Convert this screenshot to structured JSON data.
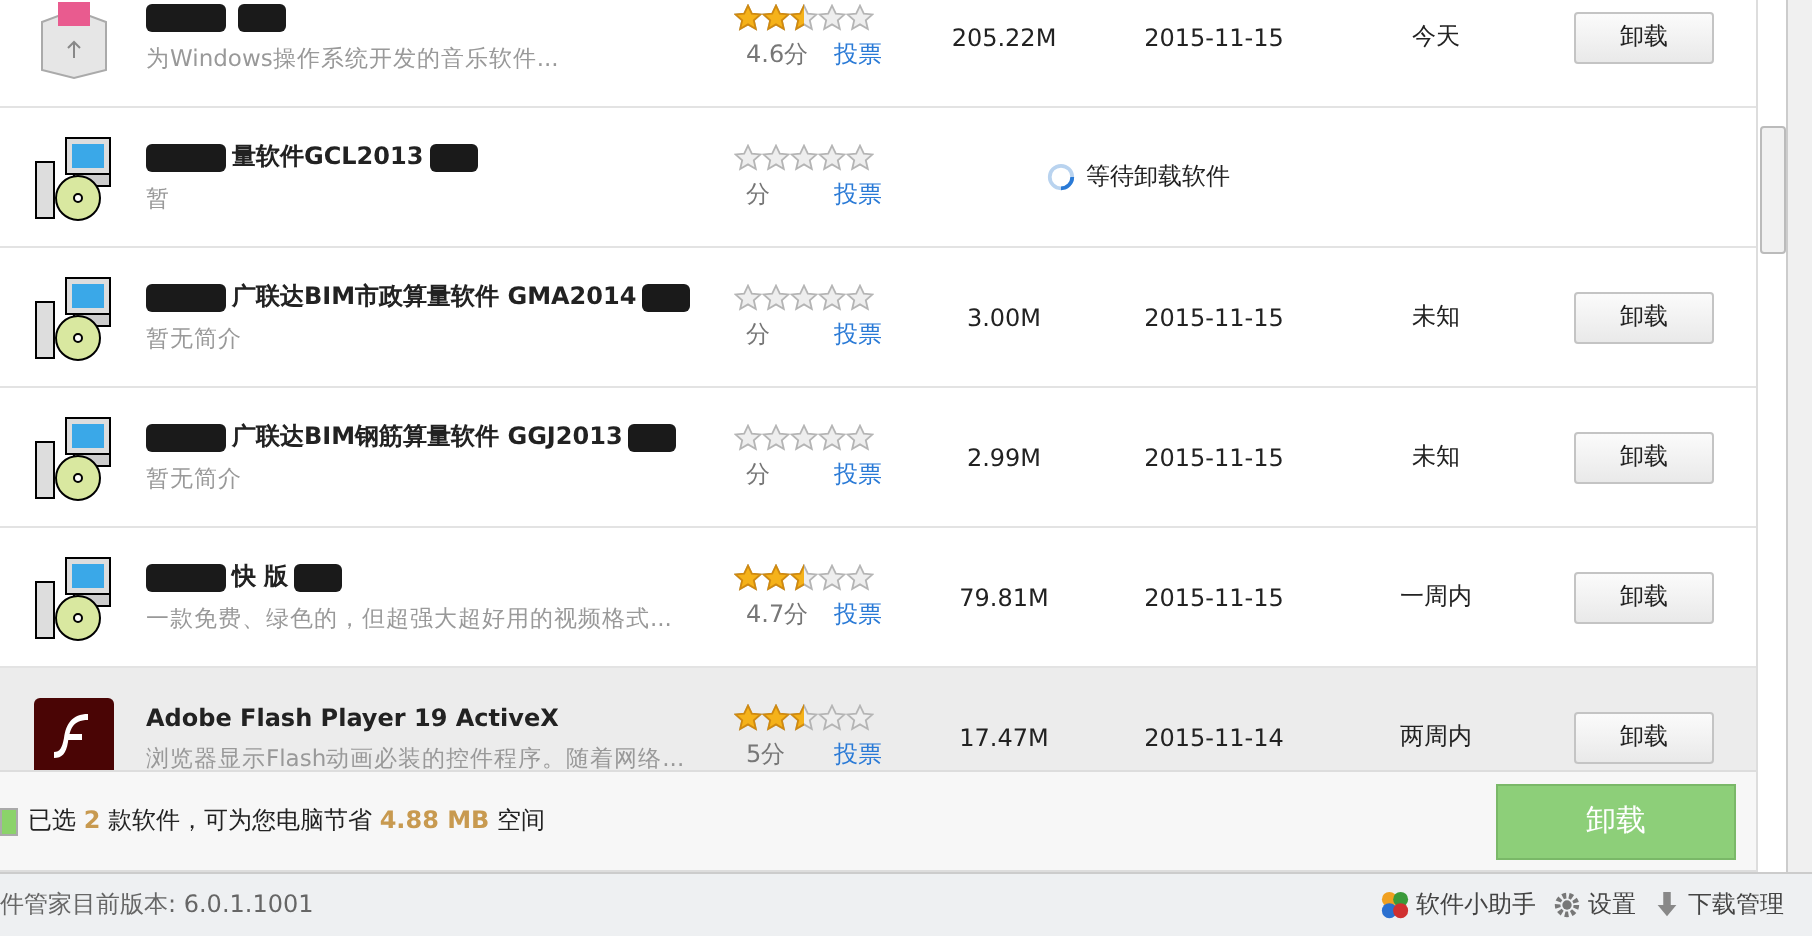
{
  "rows": [
    {
      "kind": "music",
      "name": "",
      "description": "为Windows操作系统开发的音乐软件...",
      "redacted": true,
      "stars": 2.5,
      "score": "4.6分",
      "vote": "投票",
      "size": "205.22M",
      "date": "2015-11-15",
      "last_used": "今天",
      "action": "卸载",
      "selected": false
    },
    {
      "kind": "installer",
      "name": "量软件GCL2013",
      "description": "暂",
      "redacted": true,
      "stars": 0,
      "score": "分",
      "vote": "投票",
      "status": "等待卸载软件",
      "selected": false
    },
    {
      "kind": "installer",
      "name": "广联达BIM市政算量软件 GMA2014",
      "description": "暂无简介",
      "redacted": true,
      "stars": 0,
      "score": "分",
      "vote": "投票",
      "size": "3.00M",
      "date": "2015-11-15",
      "last_used": "未知",
      "action": "卸载",
      "selected": false
    },
    {
      "kind": "installer",
      "name": "广联达BIM钢筋算量软件 GGJ2013",
      "description": "暂无简介",
      "redacted": true,
      "stars": 0,
      "score": "分",
      "vote": "投票",
      "size": "2.99M",
      "date": "2015-11-15",
      "last_used": "未知",
      "action": "卸载",
      "selected": false
    },
    {
      "kind": "installer",
      "name": "快 版",
      "description": "一款免费、绿色的，但超强大超好用的视频格式...",
      "redacted": true,
      "stars": 2.5,
      "score": "4.7分",
      "vote": "投票",
      "size": "79.81M",
      "date": "2015-11-15",
      "last_used": "一周内",
      "action": "卸载",
      "selected": false
    },
    {
      "kind": "flash",
      "name": "Adobe Flash Player 19 ActiveX",
      "description": "浏览器显示Flash动画必装的控件程序。随着网络...",
      "stars": 2.5,
      "score": "5分",
      "vote": "投票",
      "size": "17.47M",
      "date": "2015-11-14",
      "last_used": "两周内",
      "action": "卸载",
      "selected": true
    }
  ],
  "footer": {
    "checked": true,
    "summary": "已选 **2** 款软件，可为您电脑节省 **4.88 MB** 空间",
    "button": "卸载"
  },
  "status_bar": {
    "version": "件管家目前版本: 6.0.1.1001",
    "links": [
      {
        "kind": "helper",
        "label": "软件小助手"
      },
      {
        "kind": "gear",
        "label": "设置"
      },
      {
        "kind": "download",
        "label": "下载管理"
      }
    ]
  }
}
